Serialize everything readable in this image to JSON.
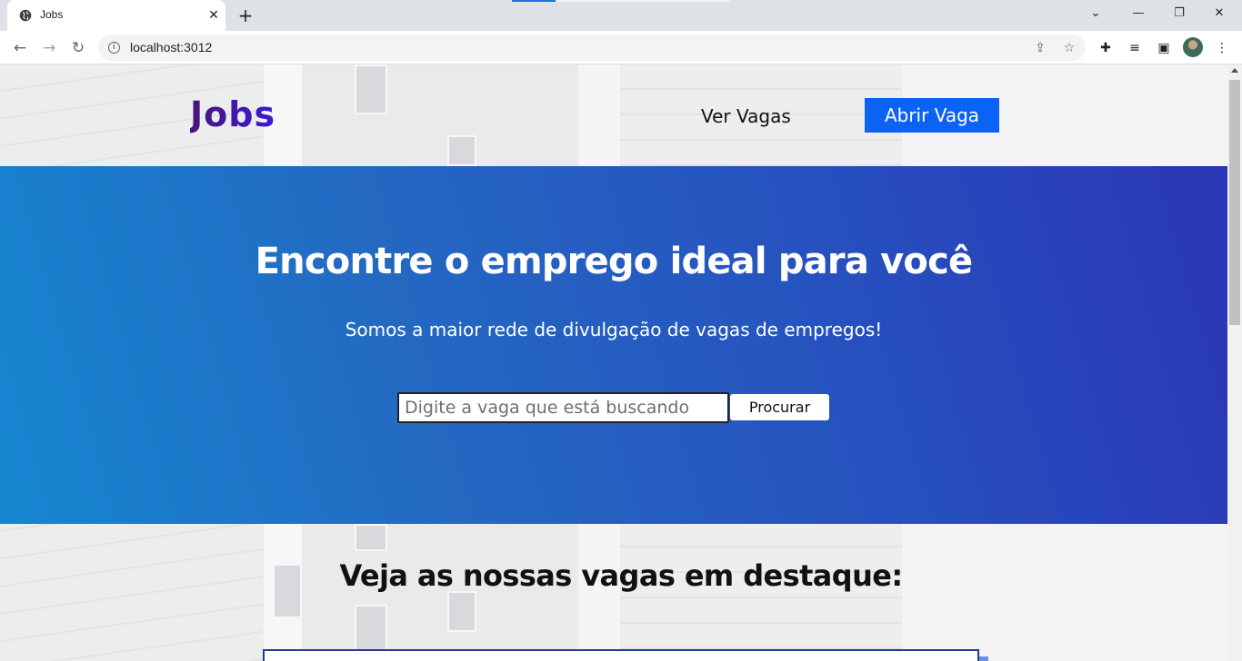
{
  "browser": {
    "tab_title": "Jobs",
    "url": "localhost:3012",
    "icons": [
      "globe-icon",
      "close-icon",
      "plus-icon",
      "back-icon",
      "forward-icon",
      "reload-icon",
      "info-icon",
      "share-icon",
      "star-icon",
      "extensions-icon",
      "media-icon",
      "sidepanel-icon",
      "menu-icon"
    ]
  },
  "header": {
    "logo": "Jobs",
    "nav_link": "Ver Vagas",
    "cta": "Abrir Vaga"
  },
  "hero": {
    "title": "Encontre o emprego ideal para você",
    "subtitle": "Somos a maior rede de divulgação de vagas de empregos!",
    "search_placeholder": "Digite a vaga que está buscando",
    "search_value": "",
    "search_button": "Procurar"
  },
  "featured": {
    "title": "Veja as nossas vagas em destaque:"
  },
  "colors": {
    "cta": "#0a63f5",
    "hero_start": "#1587d1",
    "hero_end": "#2b36b6",
    "logo_start": "#4a1473",
    "logo_end": "#3a1ad9"
  }
}
